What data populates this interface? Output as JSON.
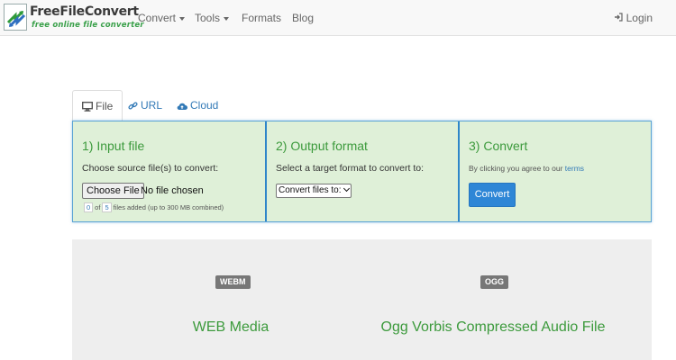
{
  "brand": {
    "name": "FreeFileConvert",
    "tagline": "free online file converter",
    "colors": {
      "accent_green": "#3c9a3c",
      "link_blue": "#337ab7",
      "button_blue": "#2e86d6"
    }
  },
  "nav": {
    "items": [
      {
        "label": "Convert",
        "dropdown": true
      },
      {
        "label": "Tools",
        "dropdown": true
      },
      {
        "label": "Formats",
        "dropdown": false
      },
      {
        "label": "Blog",
        "dropdown": false
      }
    ],
    "login": {
      "label": "Login",
      "icon": "sign-in-icon"
    }
  },
  "tabs": [
    {
      "label": "File",
      "icon": "monitor-icon",
      "active": true
    },
    {
      "label": "URL",
      "icon": "link-icon",
      "active": false
    },
    {
      "label": "Cloud",
      "icon": "cloud-upload-icon",
      "active": false
    }
  ],
  "panel": {
    "input": {
      "title": "1) Input file",
      "description": "Choose source file(s) to convert:",
      "choose_button": "Choose File",
      "no_file_text": "No file chosen",
      "count_a": "0",
      "count_of": "of",
      "count_b": "5",
      "files_added_text": "files added (up to 300 MB combined)"
    },
    "output": {
      "title": "2) Output format",
      "description": "Select a target format to convert to:",
      "select_value": "Convert files to:"
    },
    "convert": {
      "title": "3) Convert",
      "agree_text": "By clicking you agree to our",
      "terms_link": "terms",
      "button": "Convert"
    }
  },
  "formats": [
    {
      "badge": "WEBM",
      "name": "WEB Media"
    },
    {
      "badge": "OGG",
      "name": "Ogg Vorbis Compressed Audio File"
    }
  ]
}
